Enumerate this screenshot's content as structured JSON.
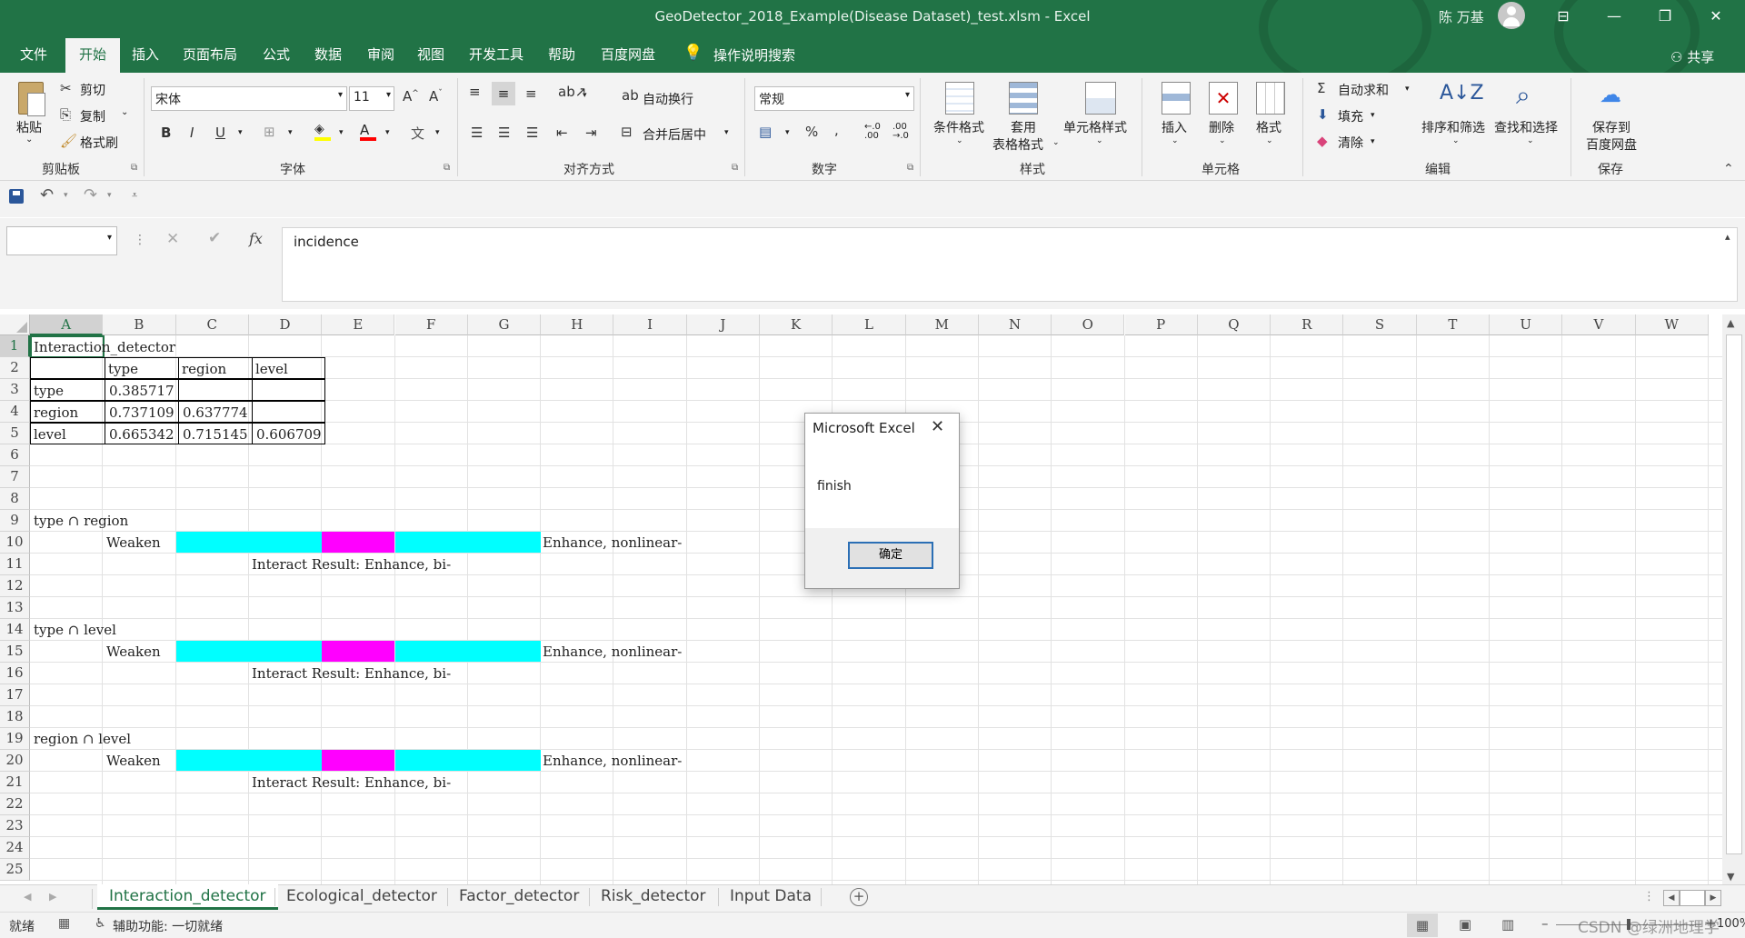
{
  "window": {
    "title": "GeoDetector_2018_Example(Disease Dataset)_test.xlsm  -  Excel",
    "user_name": "陈 万基",
    "accent": "#217346"
  },
  "ribbon_tabs": [
    "文件",
    "开始",
    "插入",
    "页面布局",
    "公式",
    "数据",
    "审阅",
    "视图",
    "开发工具",
    "帮助",
    "百度网盘"
  ],
  "tell_me": "操作说明搜索",
  "share": "共享",
  "ribbon": {
    "clipboard": {
      "paste": "粘贴",
      "cut": "剪切",
      "copy": "复制",
      "format_painter": "格式刷",
      "group": "剪贴板"
    },
    "font": {
      "name": "宋体",
      "size": "11",
      "group": "字体"
    },
    "alignment": {
      "wrap": "自动换行",
      "merge": "合并后居中",
      "group": "对齐方式"
    },
    "number": {
      "format": "常规",
      "group": "数字"
    },
    "styles": {
      "conditional": "条件格式",
      "table_line1": "套用",
      "table_line2": "表格格式",
      "cell_styles": "单元格样式",
      "group": "样式"
    },
    "cells": {
      "insert": "插入",
      "delete": "删除",
      "format": "格式",
      "group": "单元格"
    },
    "editing": {
      "autosum": "自动求和",
      "fill": "填充",
      "clear": "清除",
      "sort": "排序和筛选",
      "find": "查找和选择",
      "group": "编辑"
    },
    "save": {
      "line1": "保存到",
      "line2": "百度网盘",
      "group": "保存"
    }
  },
  "formula_bar": {
    "name_box": "",
    "fx": "fx",
    "content": "incidence"
  },
  "columns": [
    "A",
    "B",
    "C",
    "D",
    "E",
    "F",
    "G",
    "H",
    "I",
    "J",
    "K",
    "L",
    "M",
    "N",
    "O",
    "P",
    "Q",
    "R",
    "S",
    "T",
    "U",
    "V",
    "W"
  ],
  "rows": [
    "1",
    "2",
    "3",
    "4",
    "5",
    "6",
    "7",
    "8",
    "9",
    "10",
    "11",
    "12",
    "13",
    "14",
    "15",
    "16",
    "17",
    "18",
    "19",
    "20",
    "21",
    "22",
    "23",
    "24",
    "25"
  ],
  "sheet": {
    "a1": "Interaction_detector",
    "header": [
      "type",
      "region",
      "level"
    ],
    "matrix": [
      {
        "label": "type",
        "values": [
          "0.385717",
          "",
          ""
        ]
      },
      {
        "label": "region",
        "values": [
          "0.737109",
          "0.637774",
          ""
        ]
      },
      {
        "label": "level",
        "values": [
          "0.665342",
          "0.715145",
          "0.606709"
        ]
      }
    ],
    "blocks": [
      {
        "title": "type ∩ region",
        "weaken": "Weaken",
        "enhance": "Enhance, nonlinear-",
        "result": "Interact Result: Enhance, bi-"
      },
      {
        "title": "type ∩ level",
        "weaken": "Weaken",
        "enhance": "Enhance, nonlinear-",
        "result": "Interact Result: Enhance, bi-"
      },
      {
        "title": "region ∩ level",
        "weaken": "Weaken",
        "enhance": "Enhance, nonlinear-",
        "result": "Interact Result: Enhance, bi-"
      }
    ],
    "bar_colors": {
      "cyan": "#00ffff",
      "magenta": "#ff00ff"
    }
  },
  "sheet_tabs": [
    "Interaction_detector",
    "Ecological_detector",
    "Factor_detector",
    "Risk_detector",
    "Input Data"
  ],
  "status": {
    "ready": "就绪",
    "accessibility": "辅助功能: 一切就绪",
    "zoom": "100%",
    "watermark": "CSDN @绿洲地理学"
  },
  "dialog": {
    "title": "Microsoft Excel",
    "message": "finish",
    "ok": "确定"
  }
}
